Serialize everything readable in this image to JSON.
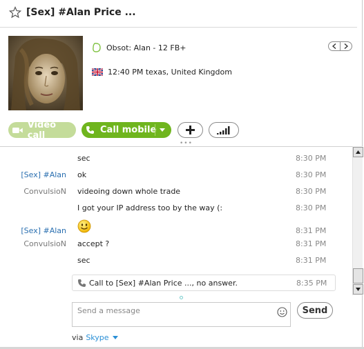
{
  "header": {
    "title": "[Sex] #Alan Price  ..."
  },
  "profile": {
    "status_text": "Obsot: Alan - 12 FB+",
    "location_text": "12:40 PM texas, United Kingdom"
  },
  "actions": {
    "video_call_label": "Video call",
    "call_mobile_label": "Call mobile"
  },
  "messages": [
    {
      "sender": "",
      "text": "sec",
      "time": "8:30 PM"
    },
    {
      "sender": "[Sex] #Alan",
      "text": "ok",
      "time": "8:30 PM"
    },
    {
      "sender": "ConvulsioN",
      "text": "videoing down whole trade",
      "time": "8:30 PM"
    },
    {
      "sender": "",
      "text": "I got your IP address too by the way (:",
      "time": "8:30 PM"
    },
    {
      "sender": "[Sex] #Alan",
      "text": "",
      "time": "8:31 PM"
    },
    {
      "sender": "ConvulsioN",
      "text": "accept ?",
      "time": "8:31 PM"
    },
    {
      "sender": "",
      "text": "sec",
      "time": "8:31 PM"
    }
  ],
  "call_event": {
    "text": "Call to [Sex] #Alan Price  ..., no answer.",
    "time": "8:35 PM"
  },
  "compose": {
    "placeholder": "Send a message",
    "send_label": "Send",
    "via_label": "via",
    "via_service": "Skype"
  },
  "colors": {
    "accent_green": "#6fb51e",
    "link_blue": "#2a8fd6"
  }
}
